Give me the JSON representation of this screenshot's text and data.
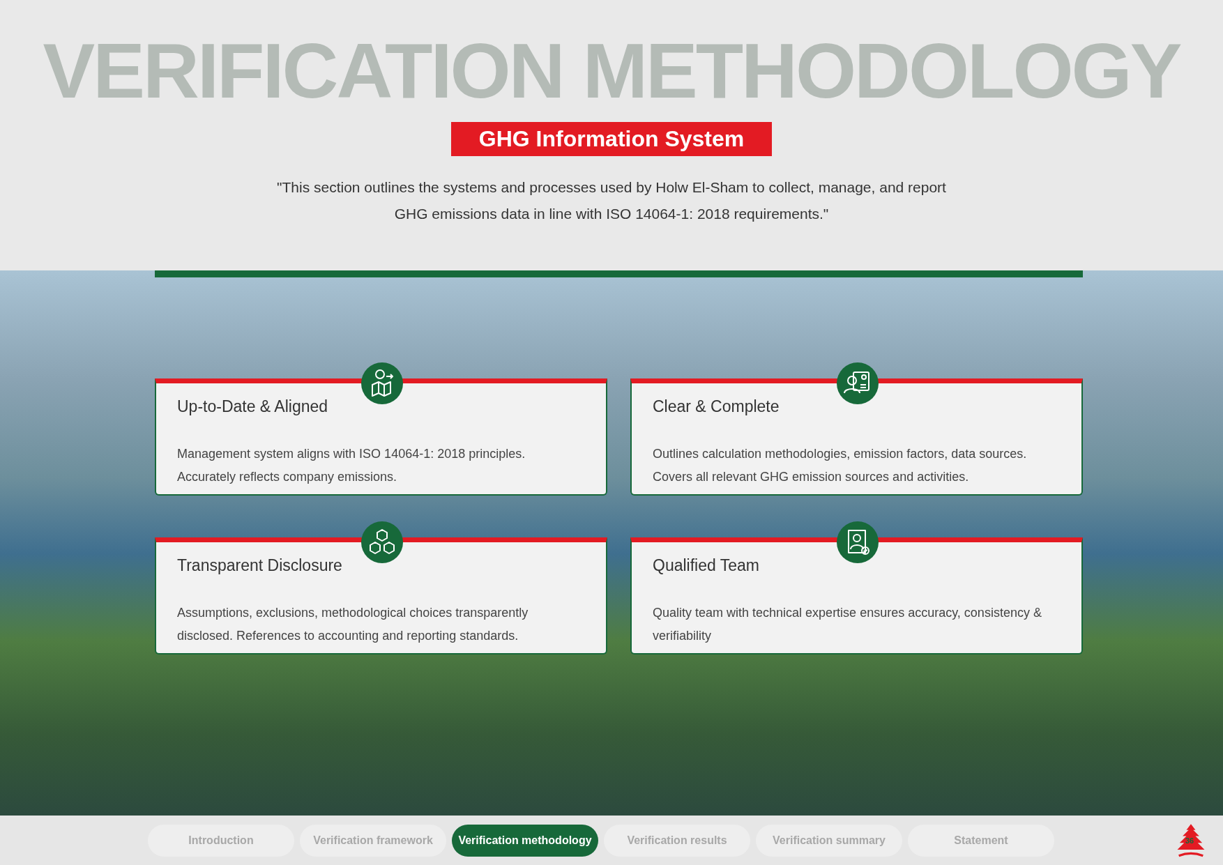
{
  "backdrop_title": "VERIFICATION METHODOLOGY",
  "banner": "GHG Information System",
  "intro": "\"This section outlines the systems and processes used by Holw El-Sham to collect, manage, and report GHG emissions data in line with ISO 14064-1: 2018 requirements.\"",
  "cards": [
    {
      "kind": "map",
      "title": "Up-to-Date & Aligned",
      "text": "Management system aligns with ISO 14064-1: 2018 principles. Accurately reflects company emissions."
    },
    {
      "kind": "profile",
      "title": "Clear & Complete",
      "text": "Outlines calculation methodologies, emission factors, data sources. Covers all relevant GHG emission sources and activities."
    },
    {
      "kind": "cubes",
      "title": "Transparent Disclosure",
      "text": "Assumptions, exclusions, methodological choices transparently disclosed. References to accounting and reporting standards."
    },
    {
      "kind": "badge",
      "title": "Qualified Team",
      "text": "Quality team with technical expertise ensures accuracy, consistency & verifiability"
    }
  ],
  "nav": [
    {
      "label": "Introduction",
      "selected": false
    },
    {
      "label": "Verification framework",
      "selected": false
    },
    {
      "label": "Verification methodology",
      "selected": true
    },
    {
      "label": "Verification results",
      "selected": false
    },
    {
      "label": "Verification summary",
      "selected": false
    },
    {
      "label": "Statement",
      "selected": false
    }
  ],
  "page_number": "36"
}
